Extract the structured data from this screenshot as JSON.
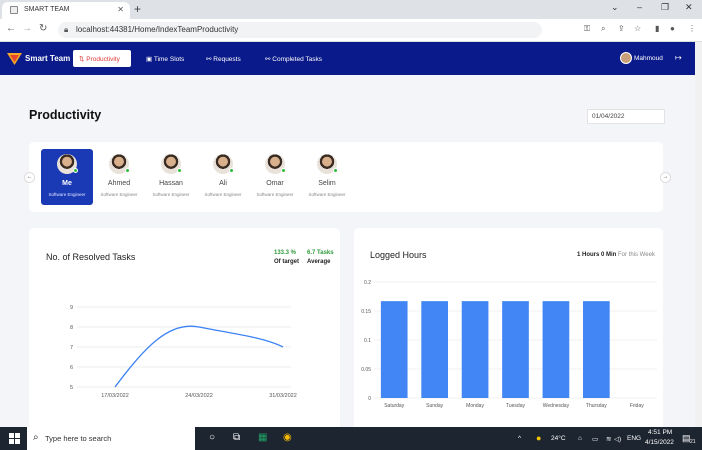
{
  "browser": {
    "tab_title": "SMART TEAM",
    "url": "localhost:44381/Home/IndexTeamProductivity"
  },
  "app": {
    "brand": "Smart Team",
    "nav": [
      {
        "label": "Productivity",
        "active": true
      },
      {
        "label": "Time Slots",
        "active": false
      },
      {
        "label": "Requests",
        "active": false
      },
      {
        "label": "Completed Tasks",
        "active": false
      }
    ],
    "user_name": "Mahmoud"
  },
  "page": {
    "title": "Productivity",
    "date": "01/04/2022"
  },
  "team": [
    {
      "name": "Me",
      "role": "Software Engineer",
      "active": true
    },
    {
      "name": "Ahmed",
      "role": "Software Engineer",
      "active": false
    },
    {
      "name": "Hassan",
      "role": "Software Engineer",
      "active": false
    },
    {
      "name": "Ali",
      "role": "Software Engineer",
      "active": false
    },
    {
      "name": "Omar",
      "role": "Software Engineer",
      "active": false
    },
    {
      "name": "Selim",
      "role": "Software Engineer",
      "active": false
    }
  ],
  "resolved": {
    "title": "No. of Resolved Tasks",
    "kpi1_value": "133.3 %",
    "kpi1_label": "Of target",
    "kpi2_value": "6.7 Tasks",
    "kpi2_label": "Average"
  },
  "logged": {
    "title": "Logged Hours",
    "summary_value": "1 Hours 0 Min",
    "summary_label": "For this Week"
  },
  "chart_data": [
    {
      "type": "line",
      "title": "No. of Resolved Tasks",
      "x_ticks": [
        "17/03/2022",
        "24/03/2022",
        "31/03/2022"
      ],
      "y_ticks": [
        5,
        6,
        7,
        8,
        9
      ],
      "ylim": [
        5,
        9
      ],
      "series": [
        {
          "points": [
            {
              "x": "17/03/2022",
              "y": 5
            },
            {
              "x": "24/03/2022",
              "y": 8
            },
            {
              "x": "31/03/2022",
              "y": 7
            }
          ]
        }
      ],
      "grid": true,
      "color": "#3b82f6"
    },
    {
      "type": "bar",
      "title": "Logged Hours",
      "categories": [
        "Saturday",
        "Sunday",
        "Monday",
        "Tuesday",
        "Wednesday",
        "Thursday",
        "Friday"
      ],
      "values": [
        0.167,
        0.167,
        0.167,
        0.167,
        0.167,
        0.167,
        0
      ],
      "y_ticks": [
        0,
        0.05,
        0.1,
        0.15,
        0.2
      ],
      "ylim": [
        0,
        0.2
      ],
      "grid": true,
      "color": "#4285f4"
    }
  ],
  "taskbar": {
    "search_placeholder": "Type here to search",
    "temperature": "24°C",
    "lang": "ENG",
    "time": "4:51 PM",
    "date": "4/15/2022",
    "notifications": "21"
  }
}
